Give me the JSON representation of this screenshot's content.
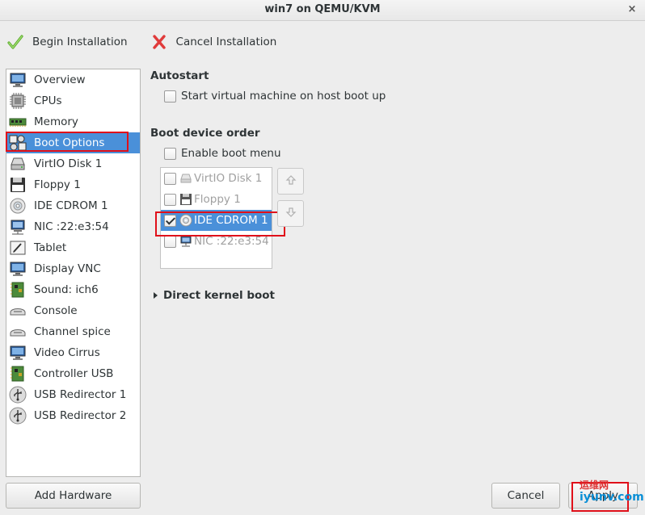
{
  "window": {
    "title": "win7 on QEMU/KVM",
    "close_glyph": "×"
  },
  "toolbar": {
    "begin_label": "Begin Installation",
    "cancel_label": "Cancel Installation"
  },
  "sidebar": {
    "items": [
      {
        "label": "Overview",
        "icon": "monitor-icon"
      },
      {
        "label": "CPUs",
        "icon": "cpu-icon"
      },
      {
        "label": "Memory",
        "icon": "memory-icon"
      },
      {
        "label": "Boot Options",
        "icon": "boot-options-icon",
        "selected": true
      },
      {
        "label": "VirtIO Disk 1",
        "icon": "disk-icon"
      },
      {
        "label": "Floppy 1",
        "icon": "floppy-icon"
      },
      {
        "label": "IDE CDROM 1",
        "icon": "cdrom-icon"
      },
      {
        "label": "NIC :22:e3:54",
        "icon": "network-icon"
      },
      {
        "label": "Tablet",
        "icon": "tablet-icon"
      },
      {
        "label": "Display VNC",
        "icon": "display-icon"
      },
      {
        "label": "Sound: ich6",
        "icon": "sound-icon"
      },
      {
        "label": "Console",
        "icon": "console-icon"
      },
      {
        "label": "Channel spice",
        "icon": "channel-icon"
      },
      {
        "label": "Video Cirrus",
        "icon": "video-icon"
      },
      {
        "label": "Controller USB",
        "icon": "controller-icon"
      },
      {
        "label": "USB Redirector 1",
        "icon": "usb-icon"
      },
      {
        "label": "USB Redirector 2",
        "icon": "usb-icon"
      }
    ],
    "add_hardware_label": "Add Hardware"
  },
  "main": {
    "autostart_title": "Autostart",
    "autostart_checkbox_label": "Start virtual machine on host boot up",
    "autostart_checked": false,
    "boot_order_title": "Boot device order",
    "enable_boot_menu_label": "Enable boot menu",
    "enable_boot_menu_checked": false,
    "boot_devices": [
      {
        "label": "VirtIO Disk 1",
        "icon": "disk-icon",
        "checked": false
      },
      {
        "label": "Floppy 1",
        "icon": "floppy-icon",
        "checked": false
      },
      {
        "label": "IDE CDROM 1",
        "icon": "cdrom-icon",
        "checked": true,
        "selected": true
      },
      {
        "label": "NIC :22:e3:54",
        "icon": "network-icon",
        "checked": false
      }
    ],
    "direct_kernel_boot_label": "Direct kernel boot"
  },
  "footer": {
    "cancel_label": "Cancel",
    "apply_label": "Apply"
  },
  "watermark": {
    "line1": "运维网",
    "line2": "iyunv.com"
  },
  "colors": {
    "selection": "#4a90d9",
    "highlight_box": "#e0101a"
  }
}
